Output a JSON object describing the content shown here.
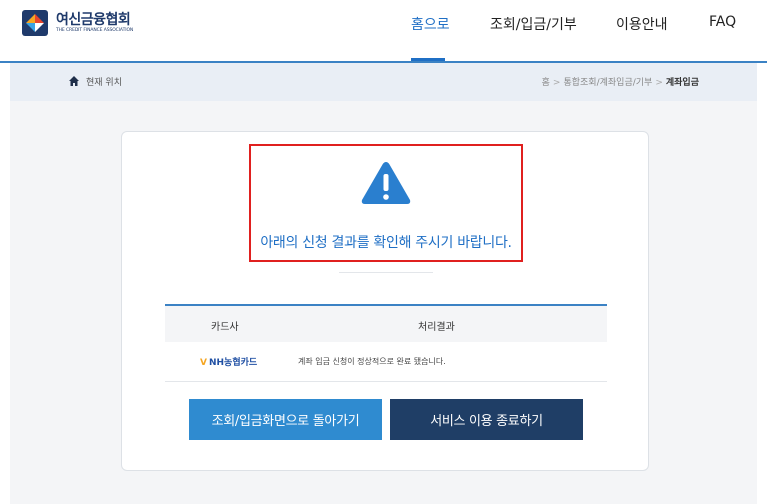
{
  "header": {
    "logo_name": "여신금융협회",
    "logo_sub": "THE CREDIT FINANCE ASSOCIATION",
    "nav": [
      {
        "label": "홈으로",
        "active": true
      },
      {
        "label": "조회/입금/기부",
        "active": false
      },
      {
        "label": "이용안내",
        "active": false
      },
      {
        "label": "FAQ",
        "active": false
      }
    ]
  },
  "breadcrumb": {
    "here_label": "현재 위치",
    "path": [
      "홈",
      "통합조회/계좌입금/기부",
      "계좌입금"
    ]
  },
  "alert": {
    "icon": "warning-icon",
    "message": "아래의 신청 결과를 확인해 주시기 바랍니다."
  },
  "table": {
    "headers": [
      "카드사",
      "처리결과"
    ],
    "rows": [
      {
        "card_company": "NH농협카드",
        "result": "계좌 입금 신청이 정상적으로 완료 됐습니다."
      }
    ]
  },
  "buttons": {
    "back_label": "조회/입금화면으로 돌아가기",
    "exit_label": "서비스 이용 종료하기"
  },
  "colors": {
    "accent": "#1f6fc5",
    "header_line": "#3b82c4",
    "alert_border": "#e0201f",
    "btn_back": "#2f8bd0",
    "btn_exit": "#1f3e66",
    "warning_icon": "#2a7fcf"
  }
}
